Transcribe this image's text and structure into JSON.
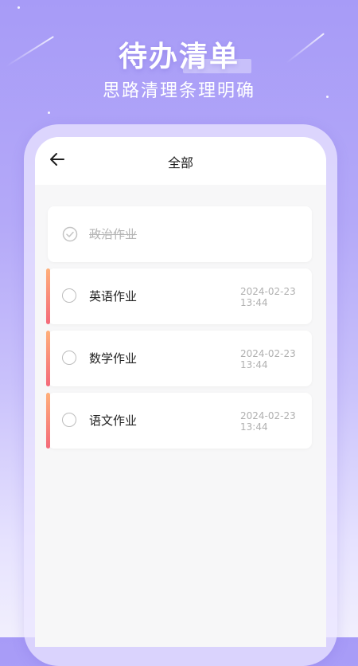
{
  "hero": {
    "title": "待办清单",
    "subtitle": "思路清理条理明确"
  },
  "nav": {
    "back_icon": "arrow-left-icon",
    "title": "全部"
  },
  "tasks": [
    {
      "name": "政治作业",
      "status": "done",
      "date": "",
      "time": ""
    },
    {
      "name": "英语作业",
      "status": "pending",
      "date": "2024-02-23",
      "time": "13:44"
    },
    {
      "name": "数学作业",
      "status": "pending",
      "date": "2024-02-23",
      "time": "13:44"
    },
    {
      "name": "语文作业",
      "status": "pending",
      "date": "2024-02-23",
      "time": "13:44"
    }
  ],
  "colors": {
    "background_top": "#a79bf7",
    "background_bottom": "#f1effd",
    "accent_bar_top": "#ffb07a",
    "accent_bar_bottom": "#f46a7a",
    "done_check": "#bdbdbd"
  }
}
